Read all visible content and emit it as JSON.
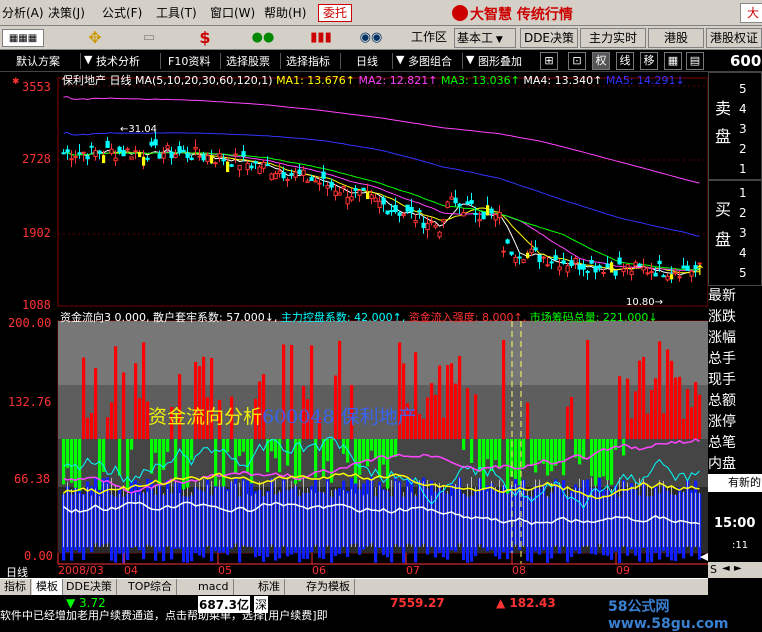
{
  "menu": {
    "items": [
      "分析(A)",
      "决策(J)",
      "公式(F)",
      "工具(T)",
      "窗口(W)",
      "帮助(H)"
    ],
    "wt": "委托",
    "brand": "大智慧 传统行情",
    "brand_right": "大"
  },
  "toolbar1": {
    "tabs": [
      "工作区",
      "基本工",
      "DDE决策",
      "主力实时",
      "港股",
      "港股权证"
    ]
  },
  "toolbar2": {
    "items": [
      "默认方案",
      "技术分析",
      "F10资料",
      "选择股票",
      "选择指标",
      "日线",
      "多图组合",
      "图形叠加"
    ],
    "buttons": [
      "权",
      "线",
      "移"
    ],
    "code": "600"
  },
  "kline": {
    "header": {
      "name": "保利地产",
      "period": "日线",
      "ma_def": "MA(5,10,20,30,60,120,1)",
      "ma1": "MA1: 13.676↑",
      "ma2": "MA2: 12.821↑",
      "ma3": "MA3: 13.036↑",
      "ma4": "MA4: 13.340↑",
      "ma5": "MA5: 14.291↓"
    },
    "yaxis": [
      "3553",
      "2728",
      "1902",
      "1088"
    ],
    "high_label": "31.04",
    "low_label": "10.80"
  },
  "indicator": {
    "header": {
      "name": "资金流向3",
      "v0": "0.000,",
      "sh": "散户套牢系数: 57.000↓,",
      "zl": "主力控盘系数: 42.000↑,",
      "lr": "资金流入强度: 8.000↑,",
      "sc": "市场筹码总量: 221.000↓"
    },
    "yaxis": [
      "200.00",
      "132.76",
      "66.38",
      "0.00"
    ],
    "overlay": "资金流向分析",
    "overlay_stock": "600048 保利地产"
  },
  "xaxis": [
    "2008/03",
    "04",
    "05",
    "06",
    "07",
    "08",
    "09"
  ],
  "xaxis_prefix": "日线",
  "right_panel": {
    "sell_label": "卖盘",
    "sell_nums": [
      "5",
      "4",
      "3",
      "2",
      "1"
    ],
    "buy_label": "买盘",
    "buy_nums": [
      "1",
      "2",
      "3",
      "4",
      "5"
    ],
    "labels": [
      "最新",
      "涨跌",
      "涨幅",
      "总手",
      "现手",
      "总额",
      "涨停",
      "总笔",
      "内盘"
    ],
    "notice": "有新的",
    "time": "15:00",
    "time_small": ":11",
    "ctrl": "S"
  },
  "bottom_tabs": [
    "指标",
    "模板",
    "DDE决策",
    "TOP综合",
    "macd",
    "标准",
    "存为模板"
  ],
  "ticker": {
    "v1": "▼ 3.72",
    "v2": "687.3亿",
    "v2b": "深",
    "v3": "7559.27",
    "v4": "▲ 182.43",
    "scroll": "软件中已经增加老用户续费通道，点击帮助菜单，选择[用户续费]即"
  },
  "watermark": "58公式网 www.58gu.com",
  "colors": {
    "up": "#ff3333",
    "down": "#00ffff",
    "yellow": "#ffff00",
    "blue": "#0000ff",
    "green": "#00ff00"
  }
}
